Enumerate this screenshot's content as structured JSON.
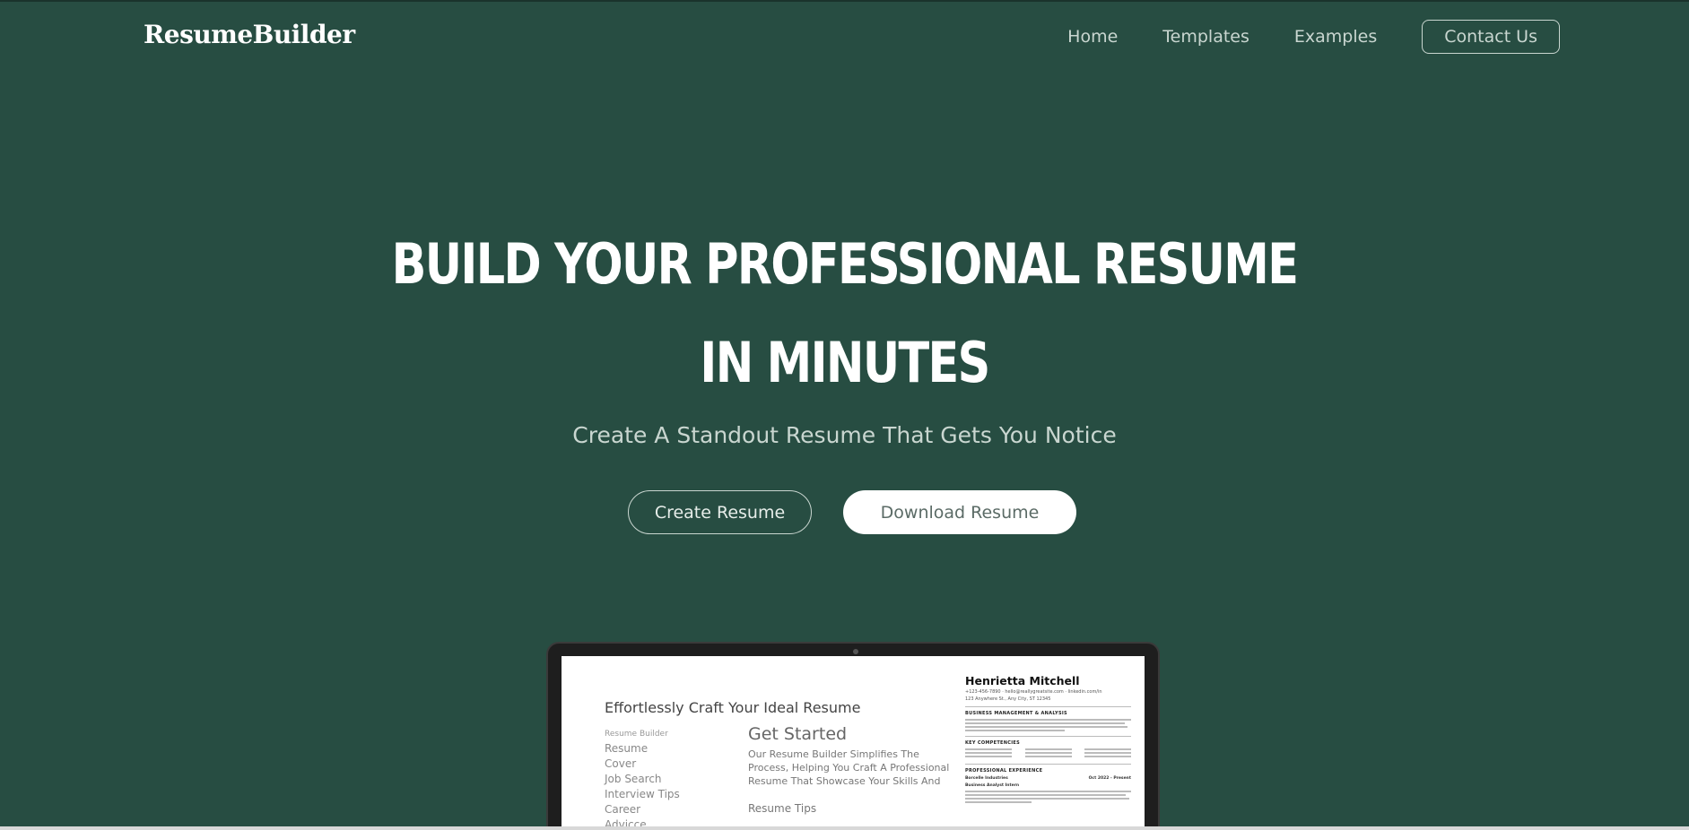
{
  "nav": {
    "logo": "ResumeBuilder",
    "links": [
      "Home",
      "Templates",
      "Examples"
    ],
    "contact_label": "Contact Us"
  },
  "hero": {
    "title_line1": "BUILD YOUR PROFESSIONAL RESUME",
    "title_line2": "IN MINUTES",
    "subtitle": "Create A Standout Resume That Gets You Notice",
    "create_button": "Create Resume",
    "download_button": "Download Resume"
  },
  "preview": {
    "title": "Effortlessly Craft Your Ideal Resume",
    "menu_heading": "Resume Builder",
    "menu_items": [
      "Resume",
      "Cover",
      "Job Search",
      "Interview Tips",
      "Career",
      "Advicce"
    ],
    "get_started": "Get Started",
    "description": "Our Resume Builder Simplifies The Process, Helping You Craft A Professional Resume That Showcase Your Skills And",
    "resume_tips": "Resume Tips",
    "resume": {
      "name": "Henrietta Mitchell",
      "contact": "+123-456-7890 · hello@reallygreatsite.com · linkedin.com/in",
      "address": "123 Anywhere St., Any City, ST 12345",
      "section1": "BUSINESS MANAGEMENT & ANALYSIS",
      "section2": "KEY COMPETENCIES",
      "section3": "PROFESSIONAL EXPERIENCE",
      "employer": "Borcelle Industries",
      "dates": "Oct 2022 - Present",
      "role": "Business Analyst Intern"
    }
  },
  "colors": {
    "background": "#274d42",
    "nav_text": "#c9d6d0",
    "white": "#ffffff"
  }
}
